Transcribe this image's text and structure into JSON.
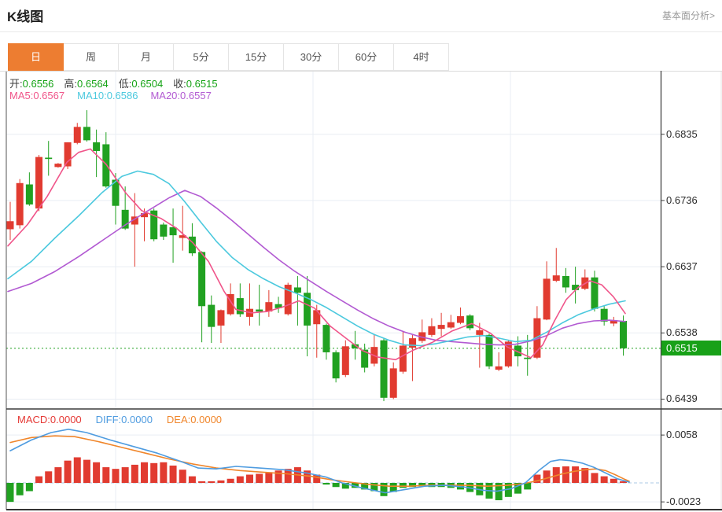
{
  "header": {
    "title": "K线图",
    "link": "基本面分析>"
  },
  "tabs": {
    "items": [
      "日",
      "周",
      "月",
      "5分",
      "15分",
      "30分",
      "60分",
      "4时"
    ],
    "selected": "日",
    "selected_index": 0
  },
  "overlay": {
    "ohlc": [
      {
        "label": "开:",
        "value": "0.6556"
      },
      {
        "label": "高:",
        "value": "0.6564"
      },
      {
        "label": "低:",
        "value": "0.6504"
      },
      {
        "label": "收:",
        "value": "0.6515"
      }
    ],
    "ma": [
      {
        "label": "MA5:",
        "value": "0.6567"
      },
      {
        "label": "MA10:",
        "value": "0.6586"
      },
      {
        "label": "MA20:",
        "value": "0.6557"
      }
    ],
    "macd": [
      {
        "label": "MACD:",
        "value": "0.0000"
      },
      {
        "label": "DIFF:",
        "value": "0.0000"
      },
      {
        "label": "DEA:",
        "value": "0.0000"
      }
    ]
  },
  "axis": {
    "main_ticks": [
      "0.6835",
      "0.6736",
      "0.6637",
      "0.6538",
      "0.6439"
    ],
    "macd_ticks": [
      "0.0058",
      "-0.0023"
    ],
    "price_tag": "0.6515"
  },
  "colors": {
    "up": "#e13b30",
    "down": "#21a121",
    "ma5": "#f0558a",
    "ma10": "#4cc9de",
    "ma20": "#b25ad2",
    "diff": "#4f9ce0",
    "dea": "#f0862b",
    "ohlc_label": "#3c3c3c",
    "ohlc_value": "#15a315",
    "macd_label": "#e53935",
    "tab_active_bg": "#ed7d31",
    "price_tag_bg": "#18a118",
    "price_line": "#21a121",
    "zero_line": "#abc8e5",
    "grid": "#e9eef4",
    "border_dark": "#3c3c3c"
  },
  "chart_data": {
    "type": "candlestick+macd",
    "title": "K线图",
    "price_axis_ticks": [
      0.6835,
      0.6736,
      0.6637,
      0.6538,
      0.6439
    ],
    "macd_axis_ticks": [
      0.0058,
      -0.0023
    ],
    "current_price": 0.6515,
    "ohlc_display": {
      "open": 0.6556,
      "high": 0.6564,
      "low": 0.6504,
      "close": 0.6515
    },
    "ma_display": {
      "ma5": 0.6567,
      "ma10": 0.6586,
      "ma20": 0.6557
    },
    "macd_display": {
      "macd": 0.0,
      "diff": 0.0,
      "dea": 0.0
    },
    "candles_format": [
      "open",
      "high",
      "low",
      "close"
    ],
    "candles": [
      [
        0.6693,
        0.6734,
        0.6677,
        0.6705
      ],
      [
        0.6699,
        0.6768,
        0.6694,
        0.6762
      ],
      [
        0.676,
        0.6778,
        0.6728,
        0.673
      ],
      [
        0.6724,
        0.6804,
        0.672,
        0.6801
      ],
      [
        0.68,
        0.6825,
        0.6773,
        0.6798
      ],
      [
        0.6786,
        0.6792,
        0.6785,
        0.6791
      ],
      [
        0.6787,
        0.6823,
        0.6783,
        0.6823
      ],
      [
        0.6822,
        0.6852,
        0.682,
        0.6846
      ],
      [
        0.6846,
        0.6871,
        0.6824,
        0.6826
      ],
      [
        0.6823,
        0.6842,
        0.6771,
        0.681
      ],
      [
        0.682,
        0.6838,
        0.6755,
        0.6757
      ],
      [
        0.6767,
        0.6777,
        0.67,
        0.6728
      ],
      [
        0.6722,
        0.6757,
        0.6692,
        0.6694
      ],
      [
        0.67,
        0.6747,
        0.6637,
        0.6712
      ],
      [
        0.6711,
        0.6724,
        0.6675,
        0.6717
      ],
      [
        0.6721,
        0.6724,
        0.6675,
        0.6678
      ],
      [
        0.67,
        0.6703,
        0.6677,
        0.6682
      ],
      [
        0.6696,
        0.6724,
        0.6643,
        0.6684
      ],
      [
        0.668,
        0.6728,
        0.6661,
        0.6684
      ],
      [
        0.6682,
        0.6702,
        0.6653,
        0.6657
      ],
      [
        0.6659,
        0.666,
        0.6524,
        0.6578
      ],
      [
        0.658,
        0.6594,
        0.6523,
        0.6547
      ],
      [
        0.6549,
        0.6573,
        0.6523,
        0.6572
      ],
      [
        0.6566,
        0.6612,
        0.6564,
        0.6596
      ],
      [
        0.659,
        0.6612,
        0.6562,
        0.6566
      ],
      [
        0.6562,
        0.6612,
        0.6549,
        0.6574
      ],
      [
        0.6573,
        0.661,
        0.6549,
        0.657
      ],
      [
        0.657,
        0.6602,
        0.6562,
        0.6584
      ],
      [
        0.6581,
        0.6592,
        0.6568,
        0.6575
      ],
      [
        0.6566,
        0.6613,
        0.6564,
        0.661
      ],
      [
        0.6606,
        0.6623,
        0.6549,
        0.6598
      ],
      [
        0.6598,
        0.6623,
        0.6503,
        0.6549
      ],
      [
        0.6551,
        0.658,
        0.6501,
        0.6572
      ],
      [
        0.655,
        0.6552,
        0.6498,
        0.6509
      ],
      [
        0.6509,
        0.6512,
        0.6464,
        0.647
      ],
      [
        0.6475,
        0.6527,
        0.6472,
        0.6518
      ],
      [
        0.6521,
        0.6541,
        0.6498,
        0.6515
      ],
      [
        0.6513,
        0.6522,
        0.6479,
        0.6486
      ],
      [
        0.6492,
        0.6535,
        0.6488,
        0.6517
      ],
      [
        0.6527,
        0.653,
        0.6436,
        0.6441
      ],
      [
        0.6441,
        0.6494,
        0.6439,
        0.6485
      ],
      [
        0.648,
        0.6541,
        0.6477,
        0.6519
      ],
      [
        0.6516,
        0.6535,
        0.6466,
        0.653
      ],
      [
        0.6526,
        0.6558,
        0.6523,
        0.6539
      ],
      [
        0.6535,
        0.656,
        0.6532,
        0.6548
      ],
      [
        0.6544,
        0.6568,
        0.6533,
        0.655
      ],
      [
        0.6546,
        0.6565,
        0.6544,
        0.6554
      ],
      [
        0.6553,
        0.6576,
        0.6551,
        0.6563
      ],
      [
        0.6564,
        0.6566,
        0.6542,
        0.6545
      ],
      [
        0.6535,
        0.6553,
        0.6486,
        0.6542
      ],
      [
        0.6535,
        0.6537,
        0.6484,
        0.6488
      ],
      [
        0.6483,
        0.6509,
        0.6481,
        0.6488
      ],
      [
        0.6488,
        0.6527,
        0.6486,
        0.6525
      ],
      [
        0.6519,
        0.6533,
        0.6488,
        0.6503
      ],
      [
        0.6501,
        0.6535,
        0.6474,
        0.6499
      ],
      [
        0.6501,
        0.6578,
        0.6499,
        0.656
      ],
      [
        0.6558,
        0.6645,
        0.6557,
        0.6619
      ],
      [
        0.6616,
        0.6665,
        0.6614,
        0.6624
      ],
      [
        0.6623,
        0.6635,
        0.6598,
        0.6606
      ],
      [
        0.661,
        0.6637,
        0.6582,
        0.6602
      ],
      [
        0.6604,
        0.6633,
        0.6602,
        0.6621
      ],
      [
        0.6621,
        0.6631,
        0.657,
        0.6574
      ],
      [
        0.6574,
        0.6578,
        0.6549,
        0.6555
      ],
      [
        0.6552,
        0.6562,
        0.6548,
        0.6557
      ],
      [
        0.6556,
        0.6564,
        0.6504,
        0.6515
      ]
    ],
    "ma5_points": [
      [
        10,
        0.6668
      ],
      [
        35,
        0.67
      ],
      [
        60,
        0.6742
      ],
      [
        85,
        0.6793
      ],
      [
        100,
        0.6808
      ],
      [
        115,
        0.6813
      ],
      [
        135,
        0.679
      ],
      [
        160,
        0.6747
      ],
      [
        180,
        0.6721
      ],
      [
        205,
        0.6709
      ],
      [
        225,
        0.6694
      ],
      [
        245,
        0.6673
      ],
      [
        265,
        0.6645
      ],
      [
        285,
        0.66
      ],
      [
        300,
        0.6573
      ],
      [
        320,
        0.6568
      ],
      [
        340,
        0.657
      ],
      [
        360,
        0.6577
      ],
      [
        380,
        0.6586
      ],
      [
        400,
        0.6575
      ],
      [
        420,
        0.6548
      ],
      [
        440,
        0.653
      ],
      [
        460,
        0.6512
      ],
      [
        480,
        0.6502
      ],
      [
        503,
        0.6498
      ],
      [
        525,
        0.6512
      ],
      [
        550,
        0.6524
      ],
      [
        575,
        0.6541
      ],
      [
        600,
        0.6552
      ],
      [
        623,
        0.6538
      ],
      [
        645,
        0.6517
      ],
      [
        660,
        0.6509
      ],
      [
        675,
        0.6501
      ],
      [
        690,
        0.652
      ],
      [
        705,
        0.6556
      ],
      [
        720,
        0.6588
      ],
      [
        735,
        0.6606
      ],
      [
        750,
        0.6616
      ],
      [
        765,
        0.661
      ],
      [
        780,
        0.6592
      ],
      [
        795,
        0.6567
      ]
    ],
    "ma10_points": [
      [
        10,
        0.6619
      ],
      [
        40,
        0.6645
      ],
      [
        70,
        0.668
      ],
      [
        100,
        0.6713
      ],
      [
        130,
        0.6748
      ],
      [
        155,
        0.6772
      ],
      [
        175,
        0.678
      ],
      [
        195,
        0.6775
      ],
      [
        215,
        0.6761
      ],
      [
        235,
        0.6734
      ],
      [
        255,
        0.6704
      ],
      [
        275,
        0.6675
      ],
      [
        295,
        0.6651
      ],
      [
        315,
        0.6633
      ],
      [
        335,
        0.6619
      ],
      [
        355,
        0.6607
      ],
      [
        375,
        0.6598
      ],
      [
        395,
        0.6588
      ],
      [
        415,
        0.6576
      ],
      [
        435,
        0.6562
      ],
      [
        455,
        0.6548
      ],
      [
        475,
        0.6536
      ],
      [
        495,
        0.6527
      ],
      [
        515,
        0.652
      ],
      [
        535,
        0.6519
      ],
      [
        555,
        0.6522
      ],
      [
        575,
        0.6527
      ],
      [
        595,
        0.6532
      ],
      [
        615,
        0.6534
      ],
      [
        635,
        0.653
      ],
      [
        655,
        0.6525
      ],
      [
        675,
        0.6527
      ],
      [
        695,
        0.6539
      ],
      [
        715,
        0.6553
      ],
      [
        735,
        0.6565
      ],
      [
        755,
        0.6574
      ],
      [
        775,
        0.6581
      ],
      [
        795,
        0.6586
      ]
    ],
    "ma20_points": [
      [
        10,
        0.66
      ],
      [
        40,
        0.6612
      ],
      [
        70,
        0.663
      ],
      [
        100,
        0.6652
      ],
      [
        130,
        0.6676
      ],
      [
        160,
        0.67
      ],
      [
        190,
        0.6722
      ],
      [
        215,
        0.674
      ],
      [
        235,
        0.6751
      ],
      [
        255,
        0.6742
      ],
      [
        275,
        0.6725
      ],
      [
        295,
        0.6706
      ],
      [
        315,
        0.6686
      ],
      [
        335,
        0.6666
      ],
      [
        355,
        0.6647
      ],
      [
        375,
        0.663
      ],
      [
        395,
        0.6615
      ],
      [
        415,
        0.66
      ],
      [
        435,
        0.6586
      ],
      [
        455,
        0.6572
      ],
      [
        475,
        0.6559
      ],
      [
        495,
        0.6548
      ],
      [
        515,
        0.6539
      ],
      [
        535,
        0.6532
      ],
      [
        555,
        0.6527
      ],
      [
        575,
        0.6525
      ],
      [
        595,
        0.6523
      ],
      [
        615,
        0.6521
      ],
      [
        635,
        0.652
      ],
      [
        655,
        0.6521
      ],
      [
        675,
        0.6526
      ],
      [
        695,
        0.6534
      ],
      [
        715,
        0.6545
      ],
      [
        735,
        0.6552
      ],
      [
        755,
        0.6556
      ],
      [
        775,
        0.6557
      ],
      [
        795,
        0.6555
      ]
    ],
    "macd_hist": [
      -0.0023,
      -0.0015,
      -0.001,
      0.0008,
      0.0014,
      0.0019,
      0.0027,
      0.0031,
      0.0028,
      0.0025,
      0.0019,
      0.0017,
      0.0019,
      0.0022,
      0.0025,
      0.0024,
      0.0025,
      0.0021,
      0.0016,
      0.0008,
      0.0002,
      0.0002,
      0.0003,
      0.0005,
      0.0008,
      0.001,
      0.0011,
      0.0013,
      0.0015,
      0.0017,
      0.0019,
      0.0015,
      0.001,
      -0.0002,
      -0.0005,
      -0.0007,
      -0.0006,
      -0.0008,
      -0.001,
      -0.0016,
      -0.0011,
      -0.0006,
      -0.0005,
      -0.0004,
      -0.0005,
      -0.0005,
      -0.0006,
      -0.0008,
      -0.0011,
      -0.0015,
      -0.0019,
      -0.0021,
      -0.0017,
      -0.0013,
      -0.0008,
      0.001,
      0.0015,
      0.0019,
      0.002,
      0.002,
      0.0018,
      0.0012,
      0.0008,
      0.0005,
      0.0002
    ],
    "diff_points": [
      [
        13,
        0.0039
      ],
      [
        40,
        0.0052
      ],
      [
        65,
        0.0061
      ],
      [
        87,
        0.0065
      ],
      [
        110,
        0.0061
      ],
      [
        140,
        0.0052
      ],
      [
        170,
        0.0044
      ],
      [
        200,
        0.0036
      ],
      [
        230,
        0.0026
      ],
      [
        252,
        0.0018
      ],
      [
        275,
        0.0017
      ],
      [
        300,
        0.002
      ],
      [
        330,
        0.0018
      ],
      [
        360,
        0.0016
      ],
      [
        390,
        0.0012
      ],
      [
        415,
        0.0007
      ],
      [
        435,
        0.0
      ],
      [
        460,
        -0.0006
      ],
      [
        490,
        -0.0012
      ],
      [
        515,
        -0.0008
      ],
      [
        540,
        -0.0004
      ],
      [
        565,
        -0.0003
      ],
      [
        590,
        -0.0005
      ],
      [
        615,
        -0.0009
      ],
      [
        632,
        -0.001
      ],
      [
        650,
        -0.0007
      ],
      [
        668,
        0.0
      ],
      [
        685,
        0.0015
      ],
      [
        700,
        0.0026
      ],
      [
        712,
        0.0028
      ],
      [
        725,
        0.0027
      ],
      [
        740,
        0.0024
      ],
      [
        755,
        0.0019
      ],
      [
        770,
        0.0012
      ],
      [
        785,
        0.0005
      ],
      [
        800,
        0.0001
      ]
    ],
    "dea_points": [
      [
        13,
        0.0049
      ],
      [
        40,
        0.0055
      ],
      [
        70,
        0.0057
      ],
      [
        95,
        0.0056
      ],
      [
        125,
        0.005
      ],
      [
        155,
        0.0043
      ],
      [
        185,
        0.0036
      ],
      [
        215,
        0.0029
      ],
      [
        245,
        0.0023
      ],
      [
        275,
        0.0018
      ],
      [
        305,
        0.0015
      ],
      [
        335,
        0.0013
      ],
      [
        365,
        0.0011
      ],
      [
        395,
        0.0008
      ],
      [
        420,
        0.0004
      ],
      [
        445,
        0.0001
      ],
      [
        470,
        -0.0002
      ],
      [
        495,
        -0.0004
      ],
      [
        520,
        -0.0004
      ],
      [
        545,
        -0.0003
      ],
      [
        570,
        -0.0003
      ],
      [
        595,
        -0.0003
      ],
      [
        620,
        -0.0004
      ],
      [
        645,
        -0.0003
      ],
      [
        665,
        -0.0001
      ],
      [
        685,
        0.0003
      ],
      [
        700,
        0.0007
      ],
      [
        715,
        0.0011
      ],
      [
        730,
        0.0014
      ],
      [
        745,
        0.0016
      ],
      [
        758,
        0.0017
      ],
      [
        770,
        0.0015
      ],
      [
        782,
        0.001
      ],
      [
        793,
        0.0005
      ],
      [
        800,
        0.0002
      ]
    ],
    "layout_hints": {
      "legend_position": "top-left-overlay",
      "grid": true,
      "main_panel": "candles with MA5/MA10/MA20",
      "sub_panel": "MACD histogram with DIFF/DEA lines",
      "current_price_line": "green dotted horizontal at 0.6515"
    }
  }
}
